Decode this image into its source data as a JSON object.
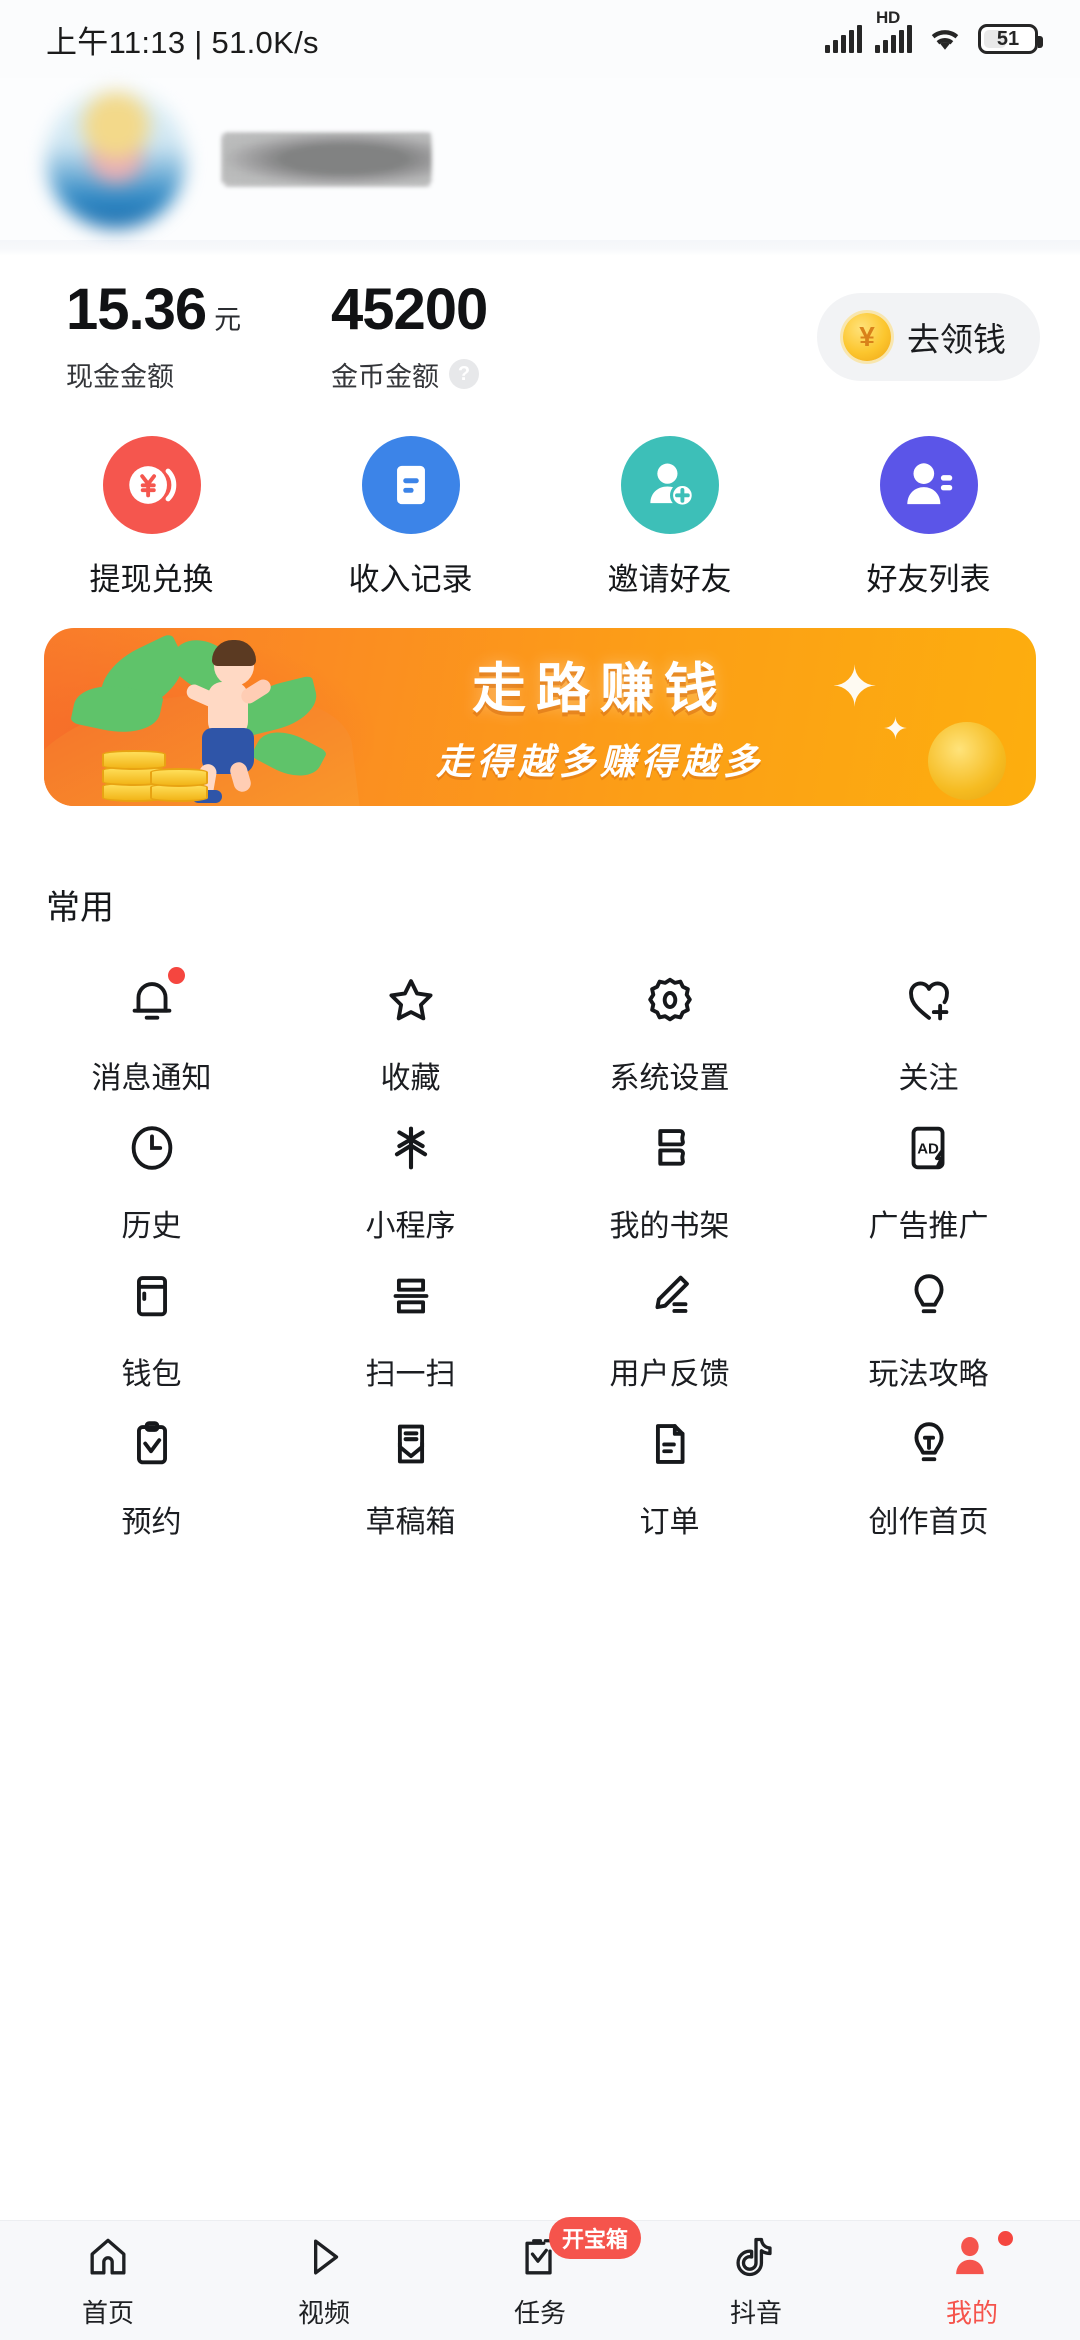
{
  "statusbar": {
    "time": "上午11:13 | 51.0K/s",
    "hd_label": "HD",
    "battery_level": "51"
  },
  "profile": {
    "avatar_name": "user-avatar-blurred",
    "username_masked": ""
  },
  "balance": {
    "cash": {
      "value": "15.36",
      "unit": "元",
      "label": "现金金额"
    },
    "coins": {
      "value": "45200",
      "label": "金币金额",
      "help_icon": "?"
    },
    "cta": {
      "label": "去领钱",
      "icon": "¥"
    }
  },
  "actions": [
    {
      "label": "提现兑换",
      "color": "#F5564E",
      "icon": "yen-coin-icon"
    },
    {
      "label": "收入记录",
      "color": "#3C84E8",
      "icon": "record-list-icon"
    },
    {
      "label": "邀请好友",
      "color": "#3DBFB8",
      "icon": "user-add-icon"
    },
    {
      "label": "好友列表",
      "color": "#5B55E8",
      "icon": "user-list-icon"
    }
  ],
  "banner": {
    "title": "走路赚钱",
    "subtitle": "走得越多赚得越多",
    "accent": "#FB8C22"
  },
  "common": {
    "section_title": "常用",
    "items": [
      {
        "label": "消息通知",
        "icon": "bell-icon",
        "dot": true
      },
      {
        "label": "收藏",
        "icon": "star-icon",
        "dot": false
      },
      {
        "label": "系统设置",
        "icon": "gear-icon",
        "dot": false
      },
      {
        "label": "关注",
        "icon": "heart-plus-icon",
        "dot": false
      },
      {
        "label": "历史",
        "icon": "clock-icon",
        "dot": false
      },
      {
        "label": "小程序",
        "icon": "mini-program-icon",
        "dot": false
      },
      {
        "label": "我的书架",
        "icon": "bookshelf-icon",
        "dot": false
      },
      {
        "label": "广告推广",
        "icon": "ad-promo-icon",
        "dot": false
      },
      {
        "label": "钱包",
        "icon": "wallet-icon",
        "dot": false
      },
      {
        "label": "扫一扫",
        "icon": "scan-icon",
        "dot": false
      },
      {
        "label": "用户反馈",
        "icon": "pencil-feedback-icon",
        "dot": false
      },
      {
        "label": "玩法攻略",
        "icon": "lightbulb-icon",
        "dot": false
      },
      {
        "label": "预约",
        "icon": "clipboard-check-icon",
        "dot": false
      },
      {
        "label": "草稿箱",
        "icon": "draft-box-icon",
        "dot": false
      },
      {
        "label": "订单",
        "icon": "document-icon",
        "dot": false
      },
      {
        "label": "创作首页",
        "icon": "bulb-pen-icon",
        "dot": false
      }
    ]
  },
  "tabbar": {
    "active_color": "#F5544C",
    "items": [
      {
        "label": "首页",
        "icon": "home-icon",
        "active": false,
        "badge": "",
        "dot": false
      },
      {
        "label": "视频",
        "icon": "play-icon",
        "active": false,
        "badge": "",
        "dot": false
      },
      {
        "label": "任务",
        "icon": "task-check-icon",
        "active": false,
        "badge": "开宝箱",
        "dot": false
      },
      {
        "label": "抖音",
        "icon": "douyin-note-icon",
        "active": false,
        "badge": "",
        "dot": false
      },
      {
        "label": "我的",
        "icon": "profile-icon",
        "active": true,
        "badge": "",
        "dot": true
      }
    ]
  }
}
